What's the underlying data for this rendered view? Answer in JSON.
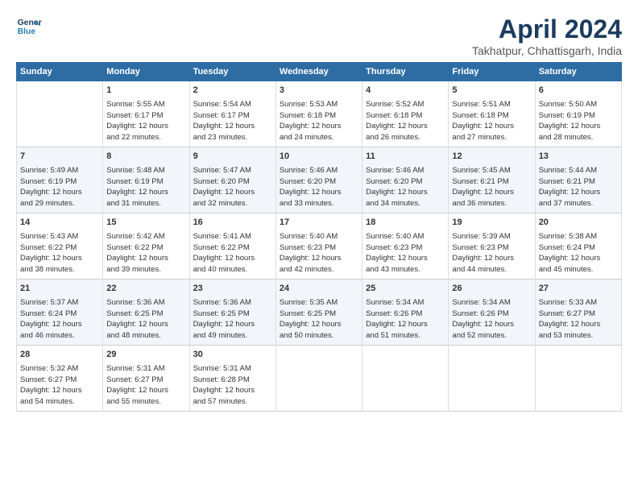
{
  "header": {
    "logo_line1": "General",
    "logo_line2": "Blue",
    "title": "April 2024",
    "subtitle": "Takhatpur, Chhattisgarh, India"
  },
  "columns": [
    "Sunday",
    "Monday",
    "Tuesday",
    "Wednesday",
    "Thursday",
    "Friday",
    "Saturday"
  ],
  "weeks": [
    [
      {
        "day": "",
        "info": ""
      },
      {
        "day": "1",
        "info": "Sunrise: 5:55 AM\nSunset: 6:17 PM\nDaylight: 12 hours\nand 22 minutes."
      },
      {
        "day": "2",
        "info": "Sunrise: 5:54 AM\nSunset: 6:17 PM\nDaylight: 12 hours\nand 23 minutes."
      },
      {
        "day": "3",
        "info": "Sunrise: 5:53 AM\nSunset: 6:18 PM\nDaylight: 12 hours\nand 24 minutes."
      },
      {
        "day": "4",
        "info": "Sunrise: 5:52 AM\nSunset: 6:18 PM\nDaylight: 12 hours\nand 26 minutes."
      },
      {
        "day": "5",
        "info": "Sunrise: 5:51 AM\nSunset: 6:18 PM\nDaylight: 12 hours\nand 27 minutes."
      },
      {
        "day": "6",
        "info": "Sunrise: 5:50 AM\nSunset: 6:19 PM\nDaylight: 12 hours\nand 28 minutes."
      }
    ],
    [
      {
        "day": "7",
        "info": "Sunrise: 5:49 AM\nSunset: 6:19 PM\nDaylight: 12 hours\nand 29 minutes."
      },
      {
        "day": "8",
        "info": "Sunrise: 5:48 AM\nSunset: 6:19 PM\nDaylight: 12 hours\nand 31 minutes."
      },
      {
        "day": "9",
        "info": "Sunrise: 5:47 AM\nSunset: 6:20 PM\nDaylight: 12 hours\nand 32 minutes."
      },
      {
        "day": "10",
        "info": "Sunrise: 5:46 AM\nSunset: 6:20 PM\nDaylight: 12 hours\nand 33 minutes."
      },
      {
        "day": "11",
        "info": "Sunrise: 5:46 AM\nSunset: 6:20 PM\nDaylight: 12 hours\nand 34 minutes."
      },
      {
        "day": "12",
        "info": "Sunrise: 5:45 AM\nSunset: 6:21 PM\nDaylight: 12 hours\nand 36 minutes."
      },
      {
        "day": "13",
        "info": "Sunrise: 5:44 AM\nSunset: 6:21 PM\nDaylight: 12 hours\nand 37 minutes."
      }
    ],
    [
      {
        "day": "14",
        "info": "Sunrise: 5:43 AM\nSunset: 6:22 PM\nDaylight: 12 hours\nand 38 minutes."
      },
      {
        "day": "15",
        "info": "Sunrise: 5:42 AM\nSunset: 6:22 PM\nDaylight: 12 hours\nand 39 minutes."
      },
      {
        "day": "16",
        "info": "Sunrise: 5:41 AM\nSunset: 6:22 PM\nDaylight: 12 hours\nand 40 minutes."
      },
      {
        "day": "17",
        "info": "Sunrise: 5:40 AM\nSunset: 6:23 PM\nDaylight: 12 hours\nand 42 minutes."
      },
      {
        "day": "18",
        "info": "Sunrise: 5:40 AM\nSunset: 6:23 PM\nDaylight: 12 hours\nand 43 minutes."
      },
      {
        "day": "19",
        "info": "Sunrise: 5:39 AM\nSunset: 6:23 PM\nDaylight: 12 hours\nand 44 minutes."
      },
      {
        "day": "20",
        "info": "Sunrise: 5:38 AM\nSunset: 6:24 PM\nDaylight: 12 hours\nand 45 minutes."
      }
    ],
    [
      {
        "day": "21",
        "info": "Sunrise: 5:37 AM\nSunset: 6:24 PM\nDaylight: 12 hours\nand 46 minutes."
      },
      {
        "day": "22",
        "info": "Sunrise: 5:36 AM\nSunset: 6:25 PM\nDaylight: 12 hours\nand 48 minutes."
      },
      {
        "day": "23",
        "info": "Sunrise: 5:36 AM\nSunset: 6:25 PM\nDaylight: 12 hours\nand 49 minutes."
      },
      {
        "day": "24",
        "info": "Sunrise: 5:35 AM\nSunset: 6:25 PM\nDaylight: 12 hours\nand 50 minutes."
      },
      {
        "day": "25",
        "info": "Sunrise: 5:34 AM\nSunset: 6:26 PM\nDaylight: 12 hours\nand 51 minutes."
      },
      {
        "day": "26",
        "info": "Sunrise: 5:34 AM\nSunset: 6:26 PM\nDaylight: 12 hours\nand 52 minutes."
      },
      {
        "day": "27",
        "info": "Sunrise: 5:33 AM\nSunset: 6:27 PM\nDaylight: 12 hours\nand 53 minutes."
      }
    ],
    [
      {
        "day": "28",
        "info": "Sunrise: 5:32 AM\nSunset: 6:27 PM\nDaylight: 12 hours\nand 54 minutes."
      },
      {
        "day": "29",
        "info": "Sunrise: 5:31 AM\nSunset: 6:27 PM\nDaylight: 12 hours\nand 55 minutes."
      },
      {
        "day": "30",
        "info": "Sunrise: 5:31 AM\nSunset: 6:28 PM\nDaylight: 12 hours\nand 57 minutes."
      },
      {
        "day": "",
        "info": ""
      },
      {
        "day": "",
        "info": ""
      },
      {
        "day": "",
        "info": ""
      },
      {
        "day": "",
        "info": ""
      }
    ]
  ]
}
